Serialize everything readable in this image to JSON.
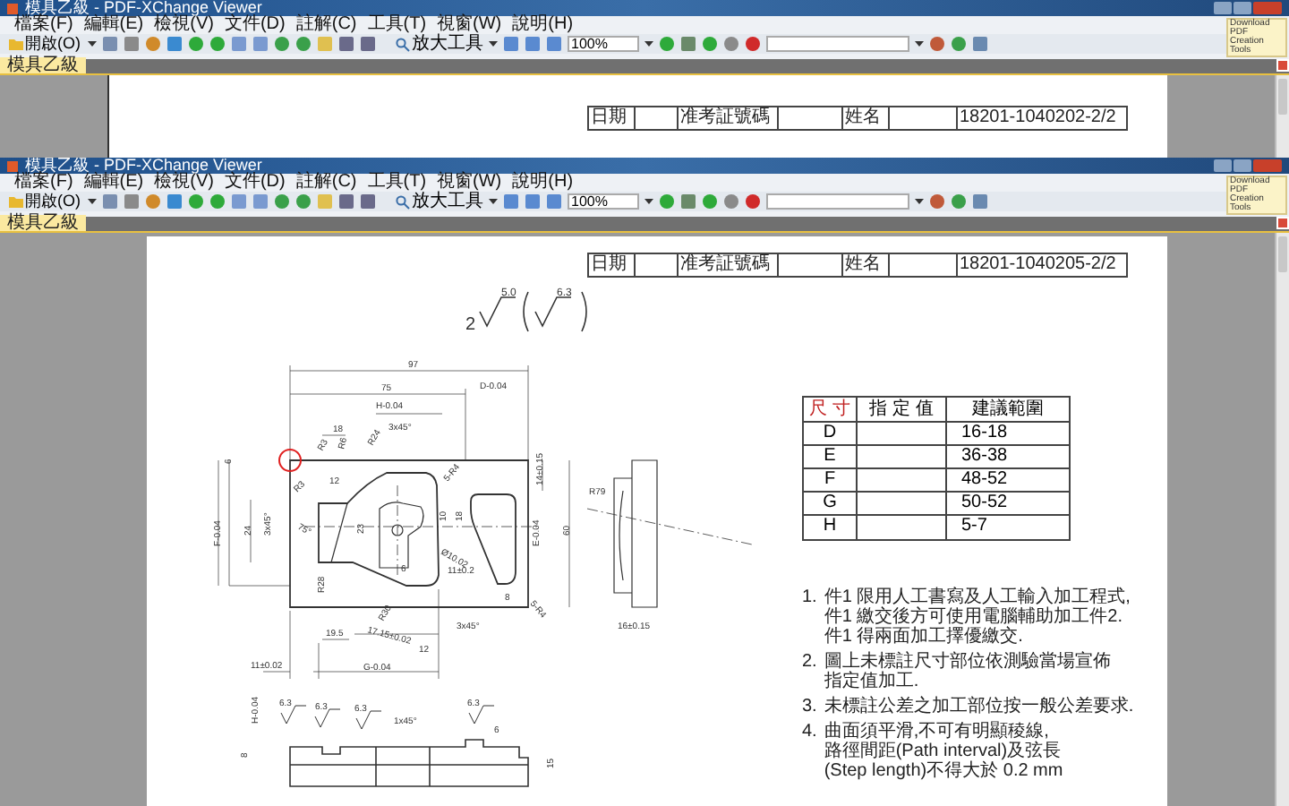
{
  "windows": [
    {
      "title": "模具乙級 - PDF-XChange Viewer",
      "menu": [
        "檔案(F)",
        "編輯(E)",
        "檢視(V)",
        "文件(D)",
        "註解(C)",
        "工具(T)",
        "視窗(W)",
        "說明(H)"
      ],
      "toolbar": {
        "open": "開啟(O)",
        "zoom_tool": "放大工具",
        "zoom": "100%"
      },
      "promo": "Download PDF Creation Tools",
      "tab": {
        "label": "模具乙級",
        "selected": true
      },
      "page": {
        "header": {
          "date_label": "日期",
          "id_label": "准考証號碼",
          "name_label": "姓名",
          "code": "18201-1040202-2/2"
        }
      }
    },
    {
      "title": "模具乙級 - PDF-XChange Viewer",
      "menu": [
        "檔案(F)",
        "編輯(E)",
        "檢視(V)",
        "文件(D)",
        "註解(C)",
        "工具(T)",
        "視窗(W)",
        "說明(H)"
      ],
      "toolbar": {
        "open": "開啟(O)",
        "zoom_tool": "放大工具",
        "zoom": "100%"
      },
      "promo": "Download PDF Creation Tools",
      "tab": {
        "label": "模具乙級",
        "selected": true
      },
      "page": {
        "header": {
          "date_label": "日期",
          "id_label": "准考証號碼",
          "name_label": "姓名",
          "code": "18201-1040205-2/2"
        },
        "surface_finish": {
          "count": "2",
          "primary": "5.0",
          "secondary": "6.3"
        },
        "drawing_labels": [
          "97",
          "75",
          "D-0.04",
          "H-0.04",
          "18",
          "3x45°",
          "R3",
          "R6",
          "R24",
          "12",
          "R3",
          "5-R4",
          "14±0.15",
          "6",
          "F-0.04",
          "24",
          "3x45°",
          "75°",
          "23",
          "10",
          "18",
          "Ø10.02",
          "6",
          "11±0.2",
          "E-0.04",
          "60",
          "R28",
          "R30",
          "8",
          "5-R4",
          "19.5",
          "17.15±0.02",
          "3x45°",
          "12",
          "11±0.02",
          "G-0.04",
          "R79",
          "16±0.15",
          "6.3",
          "6.3",
          "6.3",
          "1x45°",
          "6.3",
          "H-0.04",
          "8",
          "6",
          "15"
        ],
        "dimension_table": {
          "columns": [
            "尺 寸",
            "指 定 值",
            "建議範圍"
          ],
          "rows": [
            {
              "dimension": "D",
              "range": "16-18"
            },
            {
              "dimension": "E",
              "range": "36-38"
            },
            {
              "dimension": "F",
              "range": "48-52"
            },
            {
              "dimension": "G",
              "range": "50-52"
            },
            {
              "dimension": "H",
              "range": "5-7"
            }
          ]
        },
        "notes": [
          {
            "number": "1.",
            "lines": [
              "件1 限用人工書寫及人工輸入加工程式,",
              "件1 繳交後方可使用電腦輔助加工件2.",
              "件1 得兩面加工擇優繳交."
            ]
          },
          {
            "number": "2.",
            "lines": [
              "圖上未標註尺寸部位依測驗當場宣佈",
              "指定值加工."
            ]
          },
          {
            "number": "3.",
            "lines": [
              "未標註公差之加工部位按一般公差要求."
            ]
          },
          {
            "number": "4.",
            "lines": [
              "曲面須平滑,不可有明顯稜線,",
              "路徑間距(Path interval)及弦長",
              "(Step length)不得大於 0.2 mm"
            ]
          }
        ]
      }
    }
  ]
}
